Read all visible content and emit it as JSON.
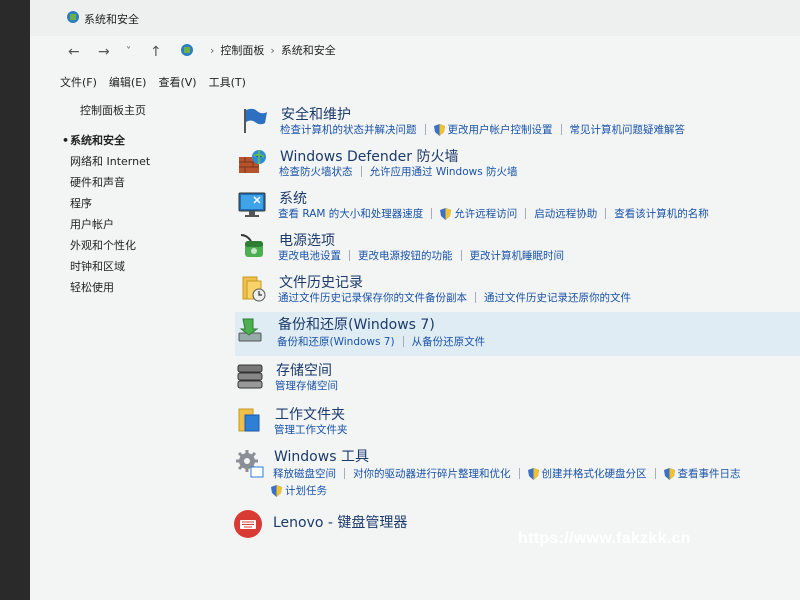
{
  "window": {
    "title": "系统和安全"
  },
  "address": {
    "root": "控制面板",
    "current": "系统和安全"
  },
  "menu": [
    "文件(F)",
    "编辑(E)",
    "查看(V)",
    "工具(T)"
  ],
  "sidebar": {
    "home": "控制面板主页",
    "items": [
      "系统和安全",
      "网络和 Internet",
      "硬件和声音",
      "程序",
      "用户帐户",
      "外观和个性化",
      "时钟和区域",
      "轻松使用"
    ],
    "active_index": 0
  },
  "categories": [
    {
      "title": "安全和维护",
      "links": [
        "检查计算机的状态并解决问题",
        "更改用户帐户控制设置",
        "常见计算机问题疑难解答"
      ],
      "shield": [
        false,
        true,
        false
      ]
    },
    {
      "title": "Windows Defender 防火墙",
      "links": [
        "检查防火墙状态",
        "允许应用通过 Windows 防火墙"
      ],
      "shield": [
        false,
        false
      ]
    },
    {
      "title": "系统",
      "links": [
        "查看 RAM 的大小和处理器速度",
        "允许远程访问",
        "启动远程协助",
        "查看该计算机的名称"
      ],
      "shield": [
        false,
        true,
        false,
        false
      ]
    },
    {
      "title": "电源选项",
      "links": [
        "更改电池设置",
        "更改电源按钮的功能",
        "更改计算机睡眠时间"
      ],
      "shield": [
        false,
        false,
        false
      ]
    },
    {
      "title": "文件历史记录",
      "links": [
        "通过文件历史记录保存你的文件备份副本",
        "通过文件历史记录还原你的文件"
      ],
      "shield": [
        false,
        false
      ]
    },
    {
      "title": "备份和还原(Windows 7)",
      "links": [
        "备份和还原(Windows 7)",
        "从备份还原文件"
      ],
      "shield": [
        false,
        false
      ]
    },
    {
      "title": "存储空间",
      "links": [
        "管理存储空间"
      ],
      "shield": [
        false
      ]
    },
    {
      "title": "工作文件夹",
      "links": [
        "管理工作文件夹"
      ],
      "shield": [
        false
      ]
    },
    {
      "title": "Windows 工具",
      "links": [
        "释放磁盘空间",
        "对你的驱动器进行碎片整理和优化",
        "创建并格式化硬盘分区",
        "查看事件日志"
      ],
      "shield": [
        false,
        false,
        true,
        true
      ],
      "links2": [
        "计划任务"
      ]
    },
    {
      "title": "Lenovo - 键盘管理器",
      "links": [],
      "shield": []
    }
  ],
  "watermark": "https://www.fakzkk.cn",
  "colors": {
    "link": "#1a53a8",
    "title": "#1b3a6a",
    "highlight": "#dfecf4"
  }
}
